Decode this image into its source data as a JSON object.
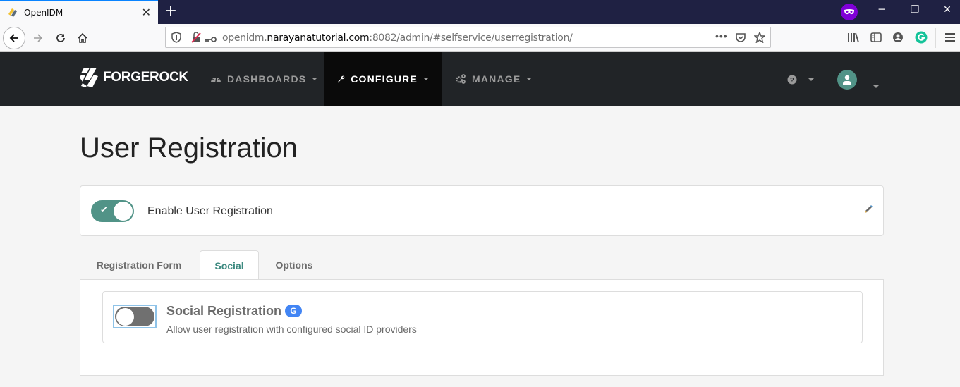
{
  "browser": {
    "tab_title": "OpenIDM",
    "url_prefix": "openidm.",
    "url_domain": "narayanatutorial.com",
    "url_suffix": ":8082/admin/#selfservice/userregistration/",
    "accent_color": "#0a84ff",
    "private_color": "#8000d7"
  },
  "appnav": {
    "brand": "FORGEROCK",
    "menus": [
      {
        "label": "DASHBOARDS",
        "icon": "dashboard-icon",
        "active": false
      },
      {
        "label": "CONFIGURE",
        "icon": "wrench-icon",
        "active": true
      },
      {
        "label": "MANAGE",
        "icon": "gears-icon",
        "active": false
      }
    ],
    "avatar_color": "#519387"
  },
  "page": {
    "title": "User Registration",
    "enable_label": "Enable User Registration",
    "enable_on": true,
    "tabs": [
      {
        "label": "Registration Form",
        "active": false
      },
      {
        "label": "Social",
        "active": true
      },
      {
        "label": "Options",
        "active": false
      }
    ],
    "social": {
      "title": "Social Registration",
      "badge": "G",
      "description": "Allow user registration with configured social ID providers",
      "enabled": false
    }
  }
}
